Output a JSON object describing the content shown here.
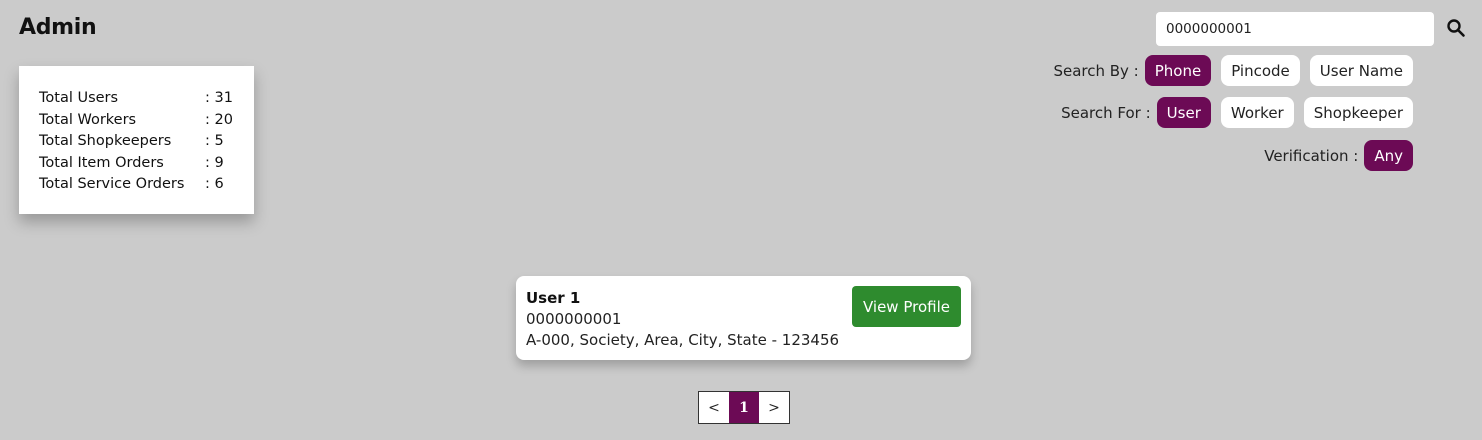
{
  "header": {
    "title": "Admin"
  },
  "stats": [
    {
      "label": "Total Users",
      "value": ": 31"
    },
    {
      "label": "Total Workers",
      "value": ": 20"
    },
    {
      "label": "Total Shopkeepers",
      "value": ": 5"
    },
    {
      "label": "Total Item Orders",
      "value": ": 9"
    },
    {
      "label": "Total Service Orders",
      "value": ": 6"
    }
  ],
  "search": {
    "value": "0000000001",
    "icon": "search-icon",
    "search_by_label": "Search By :",
    "search_by_options": [
      "Phone",
      "Pincode",
      "User Name"
    ],
    "search_by_selected": "Phone",
    "search_for_label": "Search For :",
    "search_for_options": [
      "User",
      "Worker",
      "Shopkeeper"
    ],
    "search_for_selected": "User",
    "verification_label": "Verification :",
    "verification_value": "Any"
  },
  "result": {
    "name": "User 1",
    "phone": "0000000001",
    "address": "A-000, Society, Area, City, State - 123456",
    "view_label": "View Profile"
  },
  "pagination": {
    "prev": "<",
    "current": "1",
    "next": ">"
  },
  "colors": {
    "accent": "#6c0a55",
    "success": "#2e8b2e",
    "background": "#cbcbcb"
  }
}
